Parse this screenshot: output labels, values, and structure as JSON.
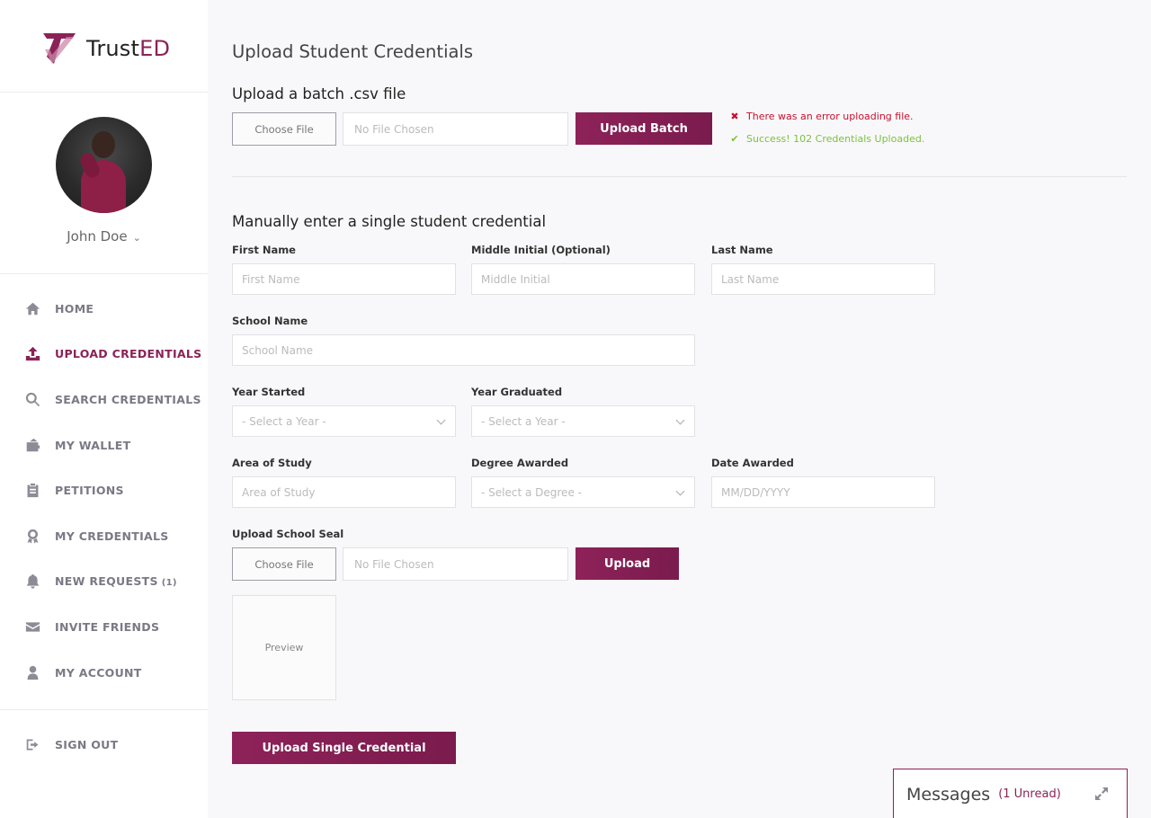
{
  "brand": {
    "name_prefix": "Trust",
    "name_suffix": "ED",
    "accent": "#8b2257"
  },
  "user": {
    "name": "John Doe"
  },
  "nav": {
    "items": [
      {
        "label": "HOME",
        "icon": "home-icon"
      },
      {
        "label": "UPLOAD CREDENTIALS",
        "icon": "upload-icon",
        "active": true
      },
      {
        "label": "SEARCH CREDENTIALS",
        "icon": "search-icon"
      },
      {
        "label": "MY WALLET",
        "icon": "wallet-icon"
      },
      {
        "label": "PETITIONS",
        "icon": "clipboard-icon"
      },
      {
        "label": "MY CREDENTIALS",
        "icon": "award-icon"
      },
      {
        "label": "NEW REQUESTS",
        "badge": "(1)",
        "icon": "bell-icon"
      },
      {
        "label": "INVITE FRIENDS",
        "icon": "envelope-icon"
      },
      {
        "label": "MY ACCOUNT",
        "icon": "user-icon"
      }
    ],
    "signout": {
      "label": "SIGN OUT",
      "icon": "sign-out-icon"
    }
  },
  "page": {
    "title": "Upload Student Credentials"
  },
  "batch": {
    "title": "Upload a batch .csv file",
    "choose_label": "Choose File",
    "file_status": "No File Chosen",
    "upload_label": "Upload Batch",
    "error_message": "There was an error uploading file.",
    "success_message": "Success! 102 Credentials Uploaded.",
    "error_color": "#c8102e",
    "success_color": "#7dc23a"
  },
  "manual": {
    "title": "Manually enter a single student credential",
    "first_name": {
      "label": "First Name",
      "placeholder": "First Name"
    },
    "middle_initial": {
      "label": "Middle Initial (Optional)",
      "placeholder": "Middle Initial"
    },
    "last_name": {
      "label": "Last Name",
      "placeholder": "Last Name"
    },
    "school_name": {
      "label": "School Name",
      "placeholder": "School Name"
    },
    "year_started": {
      "label": "Year Started",
      "value": "- Select a Year -"
    },
    "year_graduated": {
      "label": "Year Graduated",
      "value": "- Select a Year -"
    },
    "area_of_study": {
      "label": "Area of Study",
      "placeholder": "Area of Study"
    },
    "degree_awarded": {
      "label": "Degree Awarded",
      "value": "- Select a Degree -"
    },
    "date_awarded": {
      "label": "Date Awarded",
      "placeholder": "MM/DD/YYYY"
    },
    "seal": {
      "label": "Upload School Seal",
      "choose_label": "Choose File",
      "file_status": "No File Chosen",
      "upload_label": "Upload",
      "preview_label": "Preview"
    },
    "submit_label": "Upload Single Credential"
  },
  "messages": {
    "title": "Messages",
    "unread": "(1 Unread)"
  }
}
